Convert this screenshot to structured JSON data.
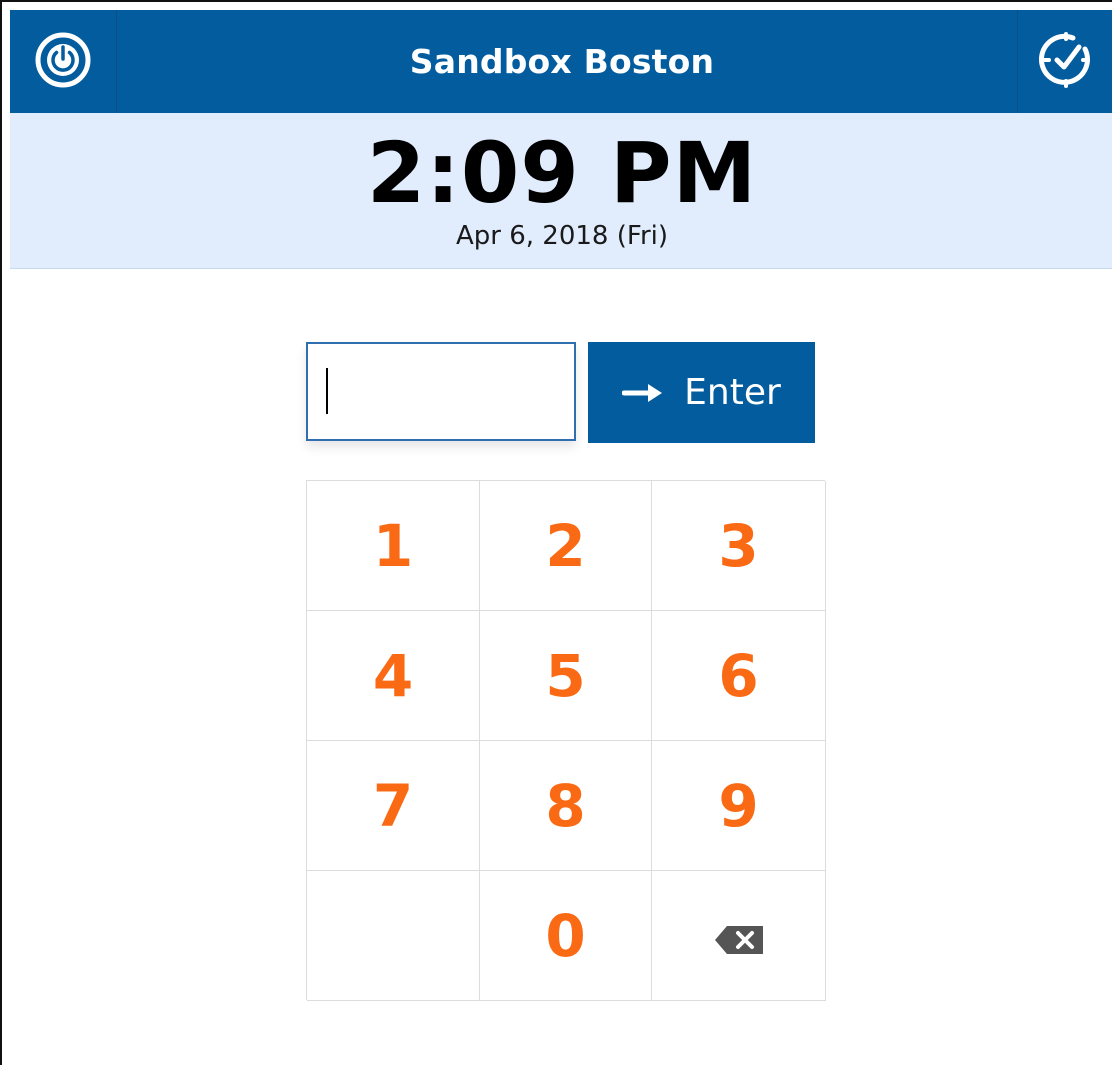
{
  "header": {
    "title": "Sandbox Boston",
    "left_icon": "power-icon",
    "right_icon": "clock-check-icon"
  },
  "clock": {
    "time": "2:09 PM",
    "date": "Apr 6, 2018 (Fri)"
  },
  "pin_entry": {
    "value": "",
    "placeholder": ""
  },
  "enter_button": {
    "label": "Enter",
    "icon": "arrow-right-icon"
  },
  "keypad": {
    "keys": [
      "1",
      "2",
      "3",
      "4",
      "5",
      "6",
      "7",
      "8",
      "9",
      "",
      "0"
    ],
    "backspace_icon": "backspace-icon"
  },
  "colors": {
    "header_bg": "#035c9e",
    "banner_bg": "#e1ecfd",
    "key_digit": "#fa6a14",
    "enter_bg": "#035c9e"
  }
}
